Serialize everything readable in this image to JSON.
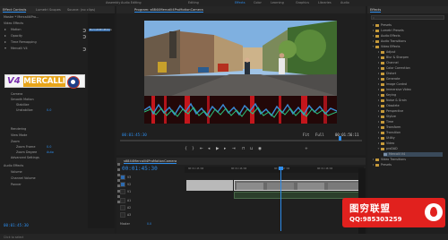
{
  "workspaces": [
    "Assembly",
    "Audio Editing",
    "Editing",
    "Effects",
    "Color",
    "Learning",
    "Graphics",
    "Libraries",
    "Audio"
  ],
  "active_workspace": "Effects",
  "effect_controls": {
    "tabs": [
      "Effect Controls",
      "Lumetri Scopes",
      "Source: (no clips)",
      "Audio Clip Mixer"
    ],
    "active_tab": "Effect Controls",
    "rows": [
      "Master * Mercalli4Pro...",
      "Video Effects",
      "Motion",
      "Opacity",
      "Time Remapping",
      "Mercalli V4",
      "Camera",
      "Smooth Motion",
      "Stabilize",
      "Unstabilize",
      "Rendering",
      "View Mode",
      "Zoom",
      "Zoom Frame",
      "Zoom Degree",
      "Advanced Settings",
      "Audio Effects",
      "Volume",
      "Channel Volume",
      "Panner"
    ],
    "values": {
      "unstabilize": "0.0",
      "zoom_frame": "0.0",
      "zoom_degree": "Auto"
    },
    "clip_label": "Mercalli4ProMotion",
    "timecode": "00:01:45:30"
  },
  "logo": {
    "version": "V4",
    "name": "MERCALLI"
  },
  "program_monitor": {
    "title": "Program: s6844Mercalli4ProMotionCamera",
    "timecode_left": "00:01:45:30",
    "fit": "Fit",
    "quality": "Full",
    "timecode_right": "00:01:56:11"
  },
  "effects_panel": {
    "title": "Effects",
    "items": [
      "Presets",
      "Lumetri Presets",
      "Audio Effects",
      "Audio Transitions",
      "Video Effects",
      "Adjust",
      "Blur & Sharpen",
      "Channel",
      "Color Correction",
      "Distort",
      "Generate",
      "Image Control",
      "Immersive Video",
      "Keying",
      "Noise & Grain",
      "Obsolete",
      "Perspective",
      "Stylize",
      "Time",
      "Transform",
      "Transition",
      "Utility",
      "Video",
      "proDAD",
      "Mercalli V4",
      "Video Transitions",
      "Presets"
    ],
    "selected": "Mercalli V4"
  },
  "timeline": {
    "tabs": [
      "s6844Mercalli4ProMotionCamera"
    ],
    "timecode": "00:01:45:30",
    "ruler": [
      "00:01:45:00",
      "00:01:46:00",
      "00:01:47:00",
      "00:01:48:00"
    ],
    "tracks": [
      "V3",
      "V2",
      "V1",
      "A1",
      "A2",
      "A3",
      "Master"
    ],
    "master_value": "0.0"
  },
  "status": "Click to select",
  "watermark": {
    "title": "图穷联盟",
    "qq": "QQ:985303259"
  }
}
